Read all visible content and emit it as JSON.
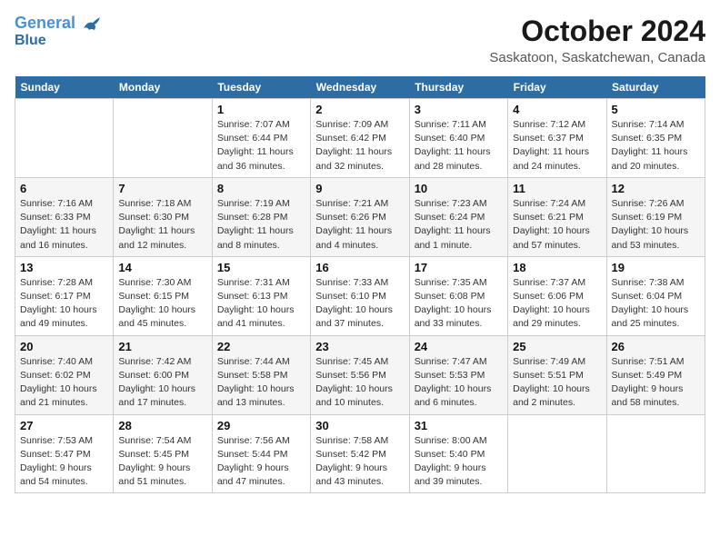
{
  "logo": {
    "line1": "General",
    "line2": "Blue"
  },
  "title": "October 2024",
  "location": "Saskatoon, Saskatchewan, Canada",
  "weekdays": [
    "Sunday",
    "Monday",
    "Tuesday",
    "Wednesday",
    "Thursday",
    "Friday",
    "Saturday"
  ],
  "weeks": [
    [
      {
        "day": "",
        "info": ""
      },
      {
        "day": "",
        "info": ""
      },
      {
        "day": "1",
        "info": "Sunrise: 7:07 AM\nSunset: 6:44 PM\nDaylight: 11 hours\nand 36 minutes."
      },
      {
        "day": "2",
        "info": "Sunrise: 7:09 AM\nSunset: 6:42 PM\nDaylight: 11 hours\nand 32 minutes."
      },
      {
        "day": "3",
        "info": "Sunrise: 7:11 AM\nSunset: 6:40 PM\nDaylight: 11 hours\nand 28 minutes."
      },
      {
        "day": "4",
        "info": "Sunrise: 7:12 AM\nSunset: 6:37 PM\nDaylight: 11 hours\nand 24 minutes."
      },
      {
        "day": "5",
        "info": "Sunrise: 7:14 AM\nSunset: 6:35 PM\nDaylight: 11 hours\nand 20 minutes."
      }
    ],
    [
      {
        "day": "6",
        "info": "Sunrise: 7:16 AM\nSunset: 6:33 PM\nDaylight: 11 hours\nand 16 minutes."
      },
      {
        "day": "7",
        "info": "Sunrise: 7:18 AM\nSunset: 6:30 PM\nDaylight: 11 hours\nand 12 minutes."
      },
      {
        "day": "8",
        "info": "Sunrise: 7:19 AM\nSunset: 6:28 PM\nDaylight: 11 hours\nand 8 minutes."
      },
      {
        "day": "9",
        "info": "Sunrise: 7:21 AM\nSunset: 6:26 PM\nDaylight: 11 hours\nand 4 minutes."
      },
      {
        "day": "10",
        "info": "Sunrise: 7:23 AM\nSunset: 6:24 PM\nDaylight: 11 hours\nand 1 minute."
      },
      {
        "day": "11",
        "info": "Sunrise: 7:24 AM\nSunset: 6:21 PM\nDaylight: 10 hours\nand 57 minutes."
      },
      {
        "day": "12",
        "info": "Sunrise: 7:26 AM\nSunset: 6:19 PM\nDaylight: 10 hours\nand 53 minutes."
      }
    ],
    [
      {
        "day": "13",
        "info": "Sunrise: 7:28 AM\nSunset: 6:17 PM\nDaylight: 10 hours\nand 49 minutes."
      },
      {
        "day": "14",
        "info": "Sunrise: 7:30 AM\nSunset: 6:15 PM\nDaylight: 10 hours\nand 45 minutes."
      },
      {
        "day": "15",
        "info": "Sunrise: 7:31 AM\nSunset: 6:13 PM\nDaylight: 10 hours\nand 41 minutes."
      },
      {
        "day": "16",
        "info": "Sunrise: 7:33 AM\nSunset: 6:10 PM\nDaylight: 10 hours\nand 37 minutes."
      },
      {
        "day": "17",
        "info": "Sunrise: 7:35 AM\nSunset: 6:08 PM\nDaylight: 10 hours\nand 33 minutes."
      },
      {
        "day": "18",
        "info": "Sunrise: 7:37 AM\nSunset: 6:06 PM\nDaylight: 10 hours\nand 29 minutes."
      },
      {
        "day": "19",
        "info": "Sunrise: 7:38 AM\nSunset: 6:04 PM\nDaylight: 10 hours\nand 25 minutes."
      }
    ],
    [
      {
        "day": "20",
        "info": "Sunrise: 7:40 AM\nSunset: 6:02 PM\nDaylight: 10 hours\nand 21 minutes."
      },
      {
        "day": "21",
        "info": "Sunrise: 7:42 AM\nSunset: 6:00 PM\nDaylight: 10 hours\nand 17 minutes."
      },
      {
        "day": "22",
        "info": "Sunrise: 7:44 AM\nSunset: 5:58 PM\nDaylight: 10 hours\nand 13 minutes."
      },
      {
        "day": "23",
        "info": "Sunrise: 7:45 AM\nSunset: 5:56 PM\nDaylight: 10 hours\nand 10 minutes."
      },
      {
        "day": "24",
        "info": "Sunrise: 7:47 AM\nSunset: 5:53 PM\nDaylight: 10 hours\nand 6 minutes."
      },
      {
        "day": "25",
        "info": "Sunrise: 7:49 AM\nSunset: 5:51 PM\nDaylight: 10 hours\nand 2 minutes."
      },
      {
        "day": "26",
        "info": "Sunrise: 7:51 AM\nSunset: 5:49 PM\nDaylight: 9 hours\nand 58 minutes."
      }
    ],
    [
      {
        "day": "27",
        "info": "Sunrise: 7:53 AM\nSunset: 5:47 PM\nDaylight: 9 hours\nand 54 minutes."
      },
      {
        "day": "28",
        "info": "Sunrise: 7:54 AM\nSunset: 5:45 PM\nDaylight: 9 hours\nand 51 minutes."
      },
      {
        "day": "29",
        "info": "Sunrise: 7:56 AM\nSunset: 5:44 PM\nDaylight: 9 hours\nand 47 minutes."
      },
      {
        "day": "30",
        "info": "Sunrise: 7:58 AM\nSunset: 5:42 PM\nDaylight: 9 hours\nand 43 minutes."
      },
      {
        "day": "31",
        "info": "Sunrise: 8:00 AM\nSunset: 5:40 PM\nDaylight: 9 hours\nand 39 minutes."
      },
      {
        "day": "",
        "info": ""
      },
      {
        "day": "",
        "info": ""
      }
    ]
  ]
}
